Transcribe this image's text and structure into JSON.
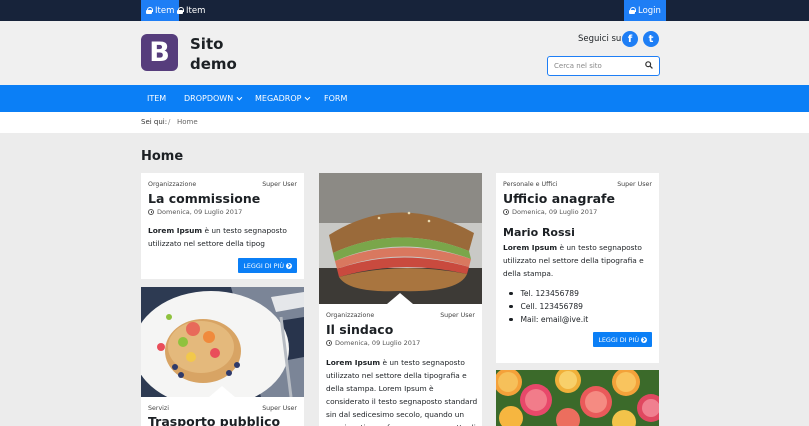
{
  "topbar": {
    "items": [
      {
        "label": "Item"
      },
      {
        "label": "Item"
      }
    ],
    "login_label": "Login"
  },
  "header": {
    "logo_letter": "B",
    "site_name": "Sito demo",
    "social_label": "Seguici su:",
    "social": [
      {
        "icon": "facebook-icon",
        "glyph": "f"
      },
      {
        "icon": "twitter-icon",
        "glyph": "t"
      }
    ],
    "search_placeholder": "Cerca nel sito"
  },
  "nav": {
    "items": [
      {
        "label": "ITEM"
      },
      {
        "label": "DROPDOWN"
      },
      {
        "label": "MEGADROP"
      },
      {
        "label": "FORM"
      }
    ]
  },
  "breadcrumb": {
    "prefix": "Sei qui:",
    "separator": "/",
    "current": "Home"
  },
  "page": {
    "title": "Home"
  },
  "cards": {
    "commissione": {
      "category": "Organizzazione",
      "author": "Super User",
      "title": "La commissione",
      "date": "Domenica, 09 Luglio 2017",
      "lead": "Lorem Ipsum",
      "text": " è un testo segnaposto utilizzato nel settore della tipog",
      "button": "LEGGI DI PIÙ"
    },
    "sindaco": {
      "category": "Organizzazione",
      "author": "Super User",
      "title": "Il sindaco",
      "date": "Domenica, 09 Luglio 2017",
      "lead": "Lorem Ipsum",
      "text": " è un testo segnaposto utilizzato nel settore della tipografia e della stampa. Lorem Ipsum è considerato il testo segnaposto standard sin dal sedicesimo secolo, quando un anonimo tipografo prese una cassetta di caratteri e"
    },
    "anagrafe": {
      "category": "Personale e Uffici",
      "author": "Super User",
      "title": "Ufficio anagrafe",
      "date": "Domenica, 09 Luglio 2017",
      "subtitle": "Mario Rossi",
      "lead": "Lorem Ipsum",
      "text": " è un testo segnaposto utilizzato nel settore della tipografia e della stampa.",
      "contacts": [
        "Tel. 123456789",
        "Cell. 123456789",
        "Mail: email@ive.it"
      ],
      "button": "LEGGI DI PIÙ"
    },
    "trasporto": {
      "category": "Servizi",
      "author": "Super User",
      "title": "Trasporto pubblico"
    }
  },
  "colors": {
    "accent": "#0b7ff6",
    "topbar": "#17233a",
    "logo": "#563d7c"
  }
}
